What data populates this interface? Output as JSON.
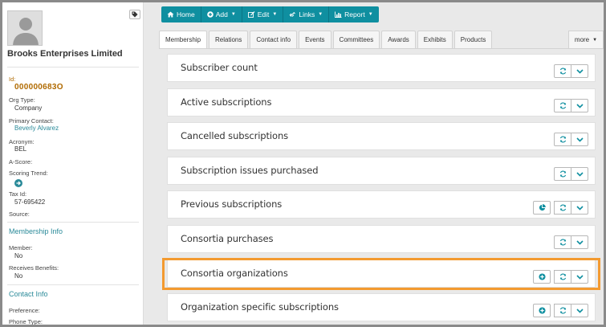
{
  "sidebar": {
    "org_name": "Brooks Enterprises Limited",
    "fields": {
      "id_label": "Id:",
      "id_value": "000000683O",
      "org_type_label": "Org Type:",
      "org_type_value": "Company",
      "primary_contact_label": "Primary Contact:",
      "primary_contact_value": "Beverly Alvarez",
      "acronym_label": "Acronym:",
      "acronym_value": "BEL",
      "ascore_label": "A-Score:",
      "scoring_trend_label": "Scoring Trend:",
      "tax_id_label": "Tax Id:",
      "tax_id_value": "57-695422",
      "source_label": "Source:"
    },
    "membership": {
      "title": "Membership Info",
      "member_label": "Member:",
      "member_value": "No",
      "benefits_label": "Receives Benefits:",
      "benefits_value": "No"
    },
    "contact": {
      "title": "Contact Info",
      "preference_label": "Preference:",
      "phone_type_label": "Phone Type:"
    }
  },
  "toolbar": {
    "home": "Home",
    "add": "Add",
    "edit": "Edit",
    "links": "Links",
    "report": "Report"
  },
  "tabs": [
    "Membership",
    "Relations",
    "Contact info",
    "Events",
    "Committees",
    "Awards",
    "Exhibits",
    "Products"
  ],
  "more_label": "more",
  "panels": [
    {
      "title": "Subscriber count"
    },
    {
      "title": "Active subscriptions"
    },
    {
      "title": "Cancelled subscriptions"
    },
    {
      "title": "Subscription issues purchased"
    },
    {
      "title": "Previous subscriptions"
    },
    {
      "title": "Consortia purchases"
    },
    {
      "title": "Consortia organizations"
    },
    {
      "title": "Organization specific subscriptions"
    }
  ],
  "colors": {
    "accent": "#0f8fa0",
    "link": "#2a8a99",
    "id_text": "#b06a00",
    "highlight": "#f39a30"
  }
}
